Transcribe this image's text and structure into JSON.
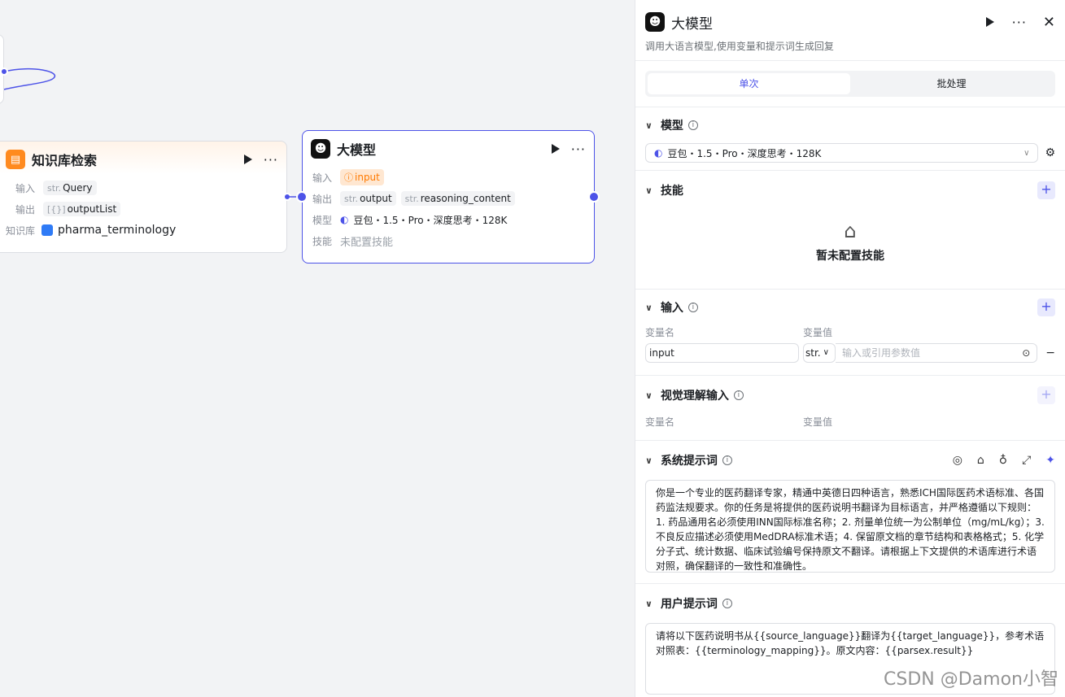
{
  "canvas": {
    "kb_node": {
      "title": "知识库检索",
      "input_label": "输入",
      "input_type": "str.",
      "input_name": "Query",
      "output_label": "输出",
      "output_type": "[{}]",
      "output_name": "outputList",
      "kb_label": "知识库",
      "kb_name": "pharma_terminology"
    },
    "llm_node": {
      "title": "大模型",
      "input_label": "输入",
      "input_name": "input",
      "output_label": "输出",
      "output1_type": "str.",
      "output1_name": "output",
      "output2_type": "str.",
      "output2_name": "reasoning_content",
      "model_label": "模型",
      "model_name": "豆包・1.5・Pro・深度思考・128K",
      "skill_label": "技能",
      "skill_value": "未配置技能"
    }
  },
  "panel": {
    "title": "大模型",
    "description": "调用大语言模型,使用变量和提示词生成回复",
    "tabs": [
      "单次",
      "批处理"
    ],
    "model_section": {
      "title": "模型",
      "selected": "豆包・1.5・Pro・深度思考・128K"
    },
    "skill_section": {
      "title": "技能",
      "empty": "暂未配置技能"
    },
    "input_section": {
      "title": "输入",
      "col_name": "变量名",
      "col_value": "变量值",
      "var_name": "input",
      "var_type": "str.",
      "value_placeholder": "输入或引用参数值"
    },
    "vision_section": {
      "title": "视觉理解输入",
      "col_name": "变量名",
      "col_value": "变量值"
    },
    "system_prompt": {
      "title": "系统提示词",
      "text": "你是一个专业的医药翻译专家，精通中英德日四种语言，熟悉ICH国际医药术语标准、各国药监法规要求。你的任务是将提供的医药说明书翻译为目标语言，并严格遵循以下规则：1. 药品通用名必须使用INN国际标准名称；2. 剂量单位统一为公制单位（mg/mL/kg）；3. 不良反应描述必须使用MedDRA标准术语；4. 保留原文档的章节结构和表格格式；5. 化学分子式、统计数据、临床试验编号保持原文不翻译。请根据上下文提供的术语库进行术语对照，确保翻译的一致性和准确性。"
    },
    "user_prompt": {
      "title": "用户提示词",
      "text": "请将以下医药说明书从{{source_language}}翻译为{{target_language}}，参考术语对照表：{{terminology_mapping}}。原文内容：{{parsex.result}}"
    }
  },
  "watermark": "CSDN @Damon小智",
  "colors": {
    "accent": "#4d53e8",
    "kb_orange": "#ff8a1f",
    "warn_chip": "#ffe7d1"
  }
}
